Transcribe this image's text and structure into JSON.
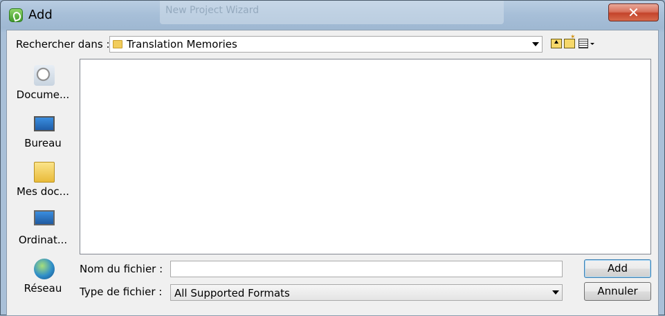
{
  "window": {
    "title": "Add",
    "background_title": "New Project Wizard"
  },
  "toolbar": {
    "look_in_label": "Rechercher dans :",
    "look_in_value": "Translation Memories"
  },
  "places": [
    {
      "label": "Docume...",
      "icon": "recent-documents-icon"
    },
    {
      "label": "Bureau",
      "icon": "desktop-icon"
    },
    {
      "label": "Mes doc...",
      "icon": "my-documents-icon"
    },
    {
      "label": "Ordinat...",
      "icon": "computer-icon"
    },
    {
      "label": "Réseau",
      "icon": "network-icon"
    }
  ],
  "form": {
    "file_name_label": "Nom du fichier :",
    "file_name_value": "",
    "file_type_label": "Type de fichier :",
    "file_type_value": "All Supported Formats"
  },
  "buttons": {
    "add": "Add",
    "cancel": "Annuler"
  },
  "colors": {
    "close_button": "#c4442b",
    "accent": "#3c7fb1"
  }
}
